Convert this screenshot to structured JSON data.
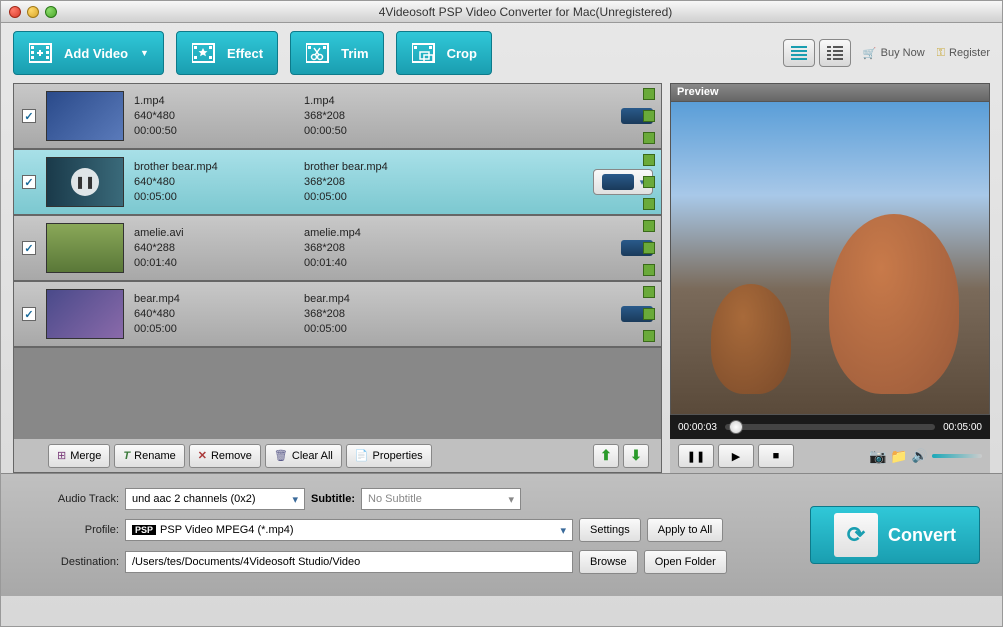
{
  "window_title": "4Videosoft PSP Video Converter for Mac(Unregistered)",
  "toolbar": {
    "add_video": "Add Video",
    "effect": "Effect",
    "trim": "Trim",
    "crop": "Crop",
    "buy_now": "Buy Now",
    "register": "Register"
  },
  "files": [
    {
      "checked": true,
      "src_name": "1.mp4",
      "src_res": "640*480",
      "src_dur": "00:00:50",
      "out_name": "1.mp4",
      "out_res": "368*208",
      "out_dur": "00:00:50",
      "selected": false,
      "playing": false
    },
    {
      "checked": true,
      "src_name": "brother bear.mp4",
      "src_res": "640*480",
      "src_dur": "00:05:00",
      "out_name": "brother bear.mp4",
      "out_res": "368*208",
      "out_dur": "00:05:00",
      "selected": true,
      "playing": true
    },
    {
      "checked": true,
      "src_name": "amelie.avi",
      "src_res": "640*288",
      "src_dur": "00:01:40",
      "out_name": "amelie.mp4",
      "out_res": "368*208",
      "out_dur": "00:01:40",
      "selected": false,
      "playing": false
    },
    {
      "checked": true,
      "src_name": "bear.mp4",
      "src_res": "640*480",
      "src_dur": "00:05:00",
      "out_name": "bear.mp4",
      "out_res": "368*208",
      "out_dur": "00:05:00",
      "selected": false,
      "playing": false
    }
  ],
  "list_actions": {
    "merge": "Merge",
    "rename": "Rename",
    "remove": "Remove",
    "clear_all": "Clear All",
    "properties": "Properties"
  },
  "preview": {
    "label": "Preview",
    "current_time": "00:00:03",
    "total_time": "00:05:00"
  },
  "bottom": {
    "audio_track_label": "Audio Track:",
    "audio_track_value": "und aac 2 channels (0x2)",
    "subtitle_label": "Subtitle:",
    "subtitle_value": "No Subtitle",
    "profile_label": "Profile:",
    "profile_value": "PSP Video MPEG4 (*.mp4)",
    "destination_label": "Destination:",
    "destination_value": "/Users/tes/Documents/4Videosoft Studio/Video",
    "settings": "Settings",
    "apply_to_all": "Apply to All",
    "browse": "Browse",
    "open_folder": "Open Folder",
    "convert": "Convert"
  }
}
